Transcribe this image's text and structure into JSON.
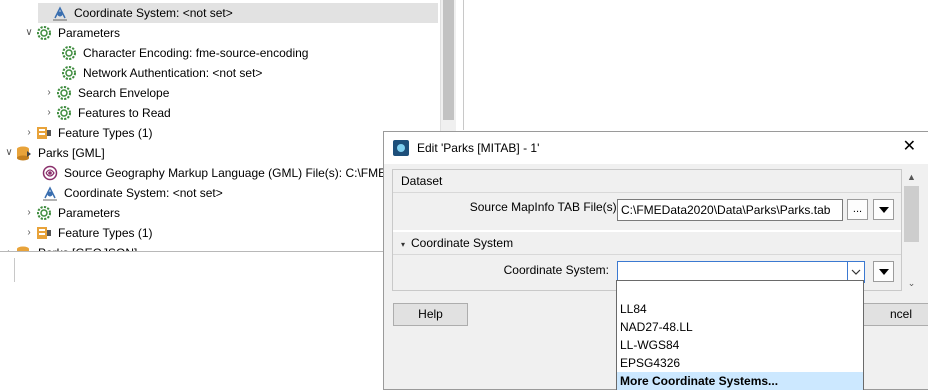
{
  "navigator": {
    "rows": [
      {
        "label": "Coordinate System: <not set>"
      },
      {
        "label": "Parameters"
      },
      {
        "label": "Character Encoding: fme-source-encoding"
      },
      {
        "label": "Network Authentication: <not set>"
      },
      {
        "label": "Search Envelope"
      },
      {
        "label": "Features to Read"
      },
      {
        "label": "Feature Types (1)"
      },
      {
        "label": "Parks [GML]"
      },
      {
        "label": "Source Geography Markup Language (GML) File(s): C:\\FMEDa"
      },
      {
        "label": "Coordinate System: <not set>"
      },
      {
        "label": "Parameters"
      },
      {
        "label": "Feature Types (1)"
      },
      {
        "label": "Parks [GEOJSON]"
      }
    ]
  },
  "dialog": {
    "title": "Edit 'Parks [MITAB] - 1'",
    "close_label": "✕",
    "dataset": {
      "heading": "Dataset",
      "source_label": "Source MapInfo TAB File(s):",
      "source_value": "C:\\FMEData2020\\Data\\Parks\\Parks.tab",
      "browse_label": "..."
    },
    "coordinate_system": {
      "heading": "Coordinate System",
      "label": "Coordinate System:",
      "value": ""
    },
    "help_label": "Help",
    "cancel_label": "ncel"
  },
  "dropdown": {
    "options": [
      "LL84",
      "NAD27-48.LL",
      "LL-WGS84",
      "EPSG4326",
      "More Coordinate Systems..."
    ],
    "highlighted": "More Coordinate Systems..."
  },
  "colors": {
    "selection_gray": "#e2e2e2",
    "focus_blue": "#3b79d1",
    "highlight_blue": "#cce8ff",
    "gear_green": "#3d8b3d",
    "feature_orange": "#e8a33a"
  },
  "icons": {
    "coordinate_system": "coordinate-system-icon",
    "parameters": "gear-icon",
    "feature_types": "feature-types-icon",
    "dataset": "dataset-icon",
    "source_file": "source-file-icon",
    "app": "fme-app-icon"
  }
}
